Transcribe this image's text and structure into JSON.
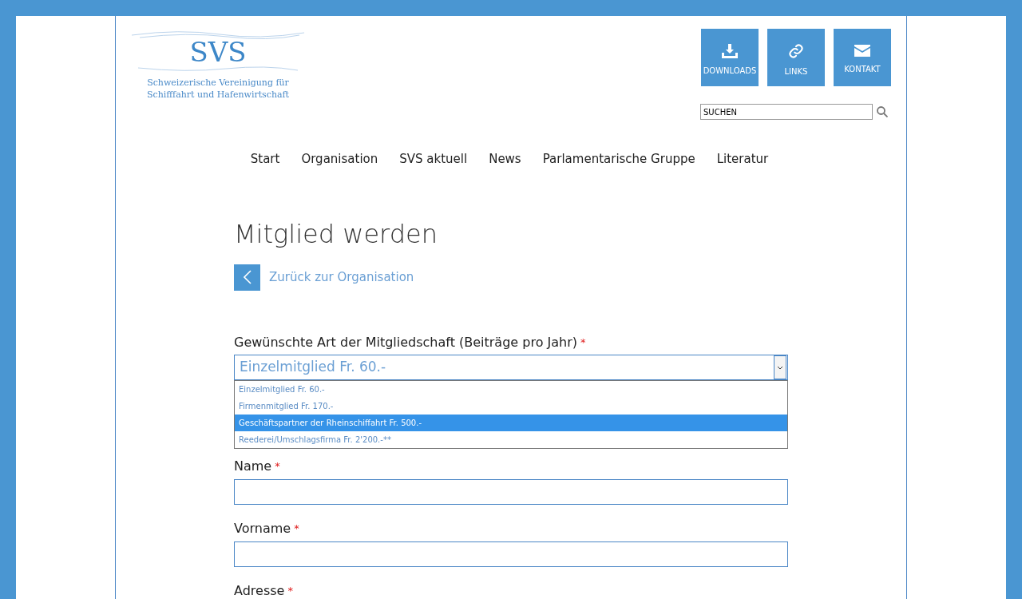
{
  "logo": {
    "initials": "SVS",
    "tagline_1": "Schweizerische Vereinigung für",
    "tagline_2": "Schifffahrt und Hafenwirtschaft"
  },
  "quick_links": [
    {
      "kind": "download",
      "label": "DOWNLOADS"
    },
    {
      "kind": "link",
      "label": "LINKS"
    },
    {
      "kind": "mail",
      "label": "KONTAKT"
    }
  ],
  "search": {
    "value": "SUCHEN"
  },
  "nav": [
    "Start",
    "Organisation",
    "SVS aktuell",
    "News",
    "Parlamentarische Gruppe",
    "Literatur"
  ],
  "page_title": "Mitglied werden",
  "back_link": "Zurück zur Organisation",
  "membership": {
    "label": "Gewünschte Art der Mitgliedschaft (Beiträge pro Jahr)",
    "required_mark": "*",
    "value": "Einzelmitglied Fr. 60.-",
    "expanded": true,
    "options": [
      {
        "label": "Einzelmitglied Fr. 60.-",
        "highlighted": false
      },
      {
        "label": "Firmenmitglied Fr. 170.-",
        "highlighted": false
      },
      {
        "label": "Geschäftspartner der Rheinschiffahrt Fr. 500.-",
        "highlighted": true
      },
      {
        "label": "Reederei/Umschlagsfirma Fr. 2'200.-**",
        "highlighted": false
      }
    ]
  },
  "fields": [
    {
      "label": "Name",
      "required_mark": "*",
      "kind": "input"
    },
    {
      "label": "Vorname",
      "required_mark": "*",
      "kind": "input"
    },
    {
      "label": "Adresse",
      "required_mark": "*",
      "kind": "label_only"
    }
  ]
}
